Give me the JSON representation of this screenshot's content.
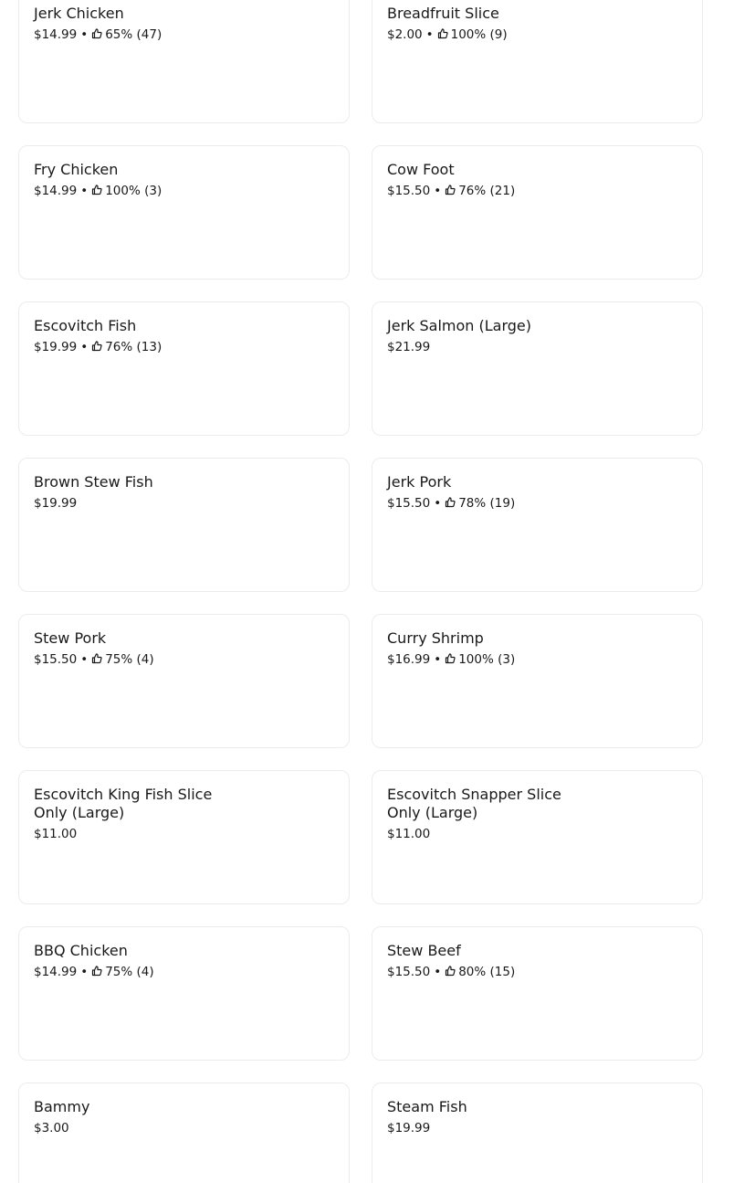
{
  "menu": {
    "items": [
      {
        "name": "Jerk Chicken",
        "price": "$14.99",
        "rating": "65% (47)"
      },
      {
        "name": "Breadfruit Slice",
        "price": "$2.00",
        "rating": "100% (9)"
      },
      {
        "name": "Fry Chicken",
        "price": "$14.99",
        "rating": "100% (3)"
      },
      {
        "name": "Cow Foot",
        "price": "$15.50",
        "rating": "76% (21)"
      },
      {
        "name": "Escovitch Fish",
        "price": "$19.99",
        "rating": "76% (13)"
      },
      {
        "name": "Jerk Salmon (Large)",
        "price": "$21.99",
        "rating": null
      },
      {
        "name": "Brown Stew Fish",
        "price": "$19.99",
        "rating": null
      },
      {
        "name": "Jerk Pork",
        "price": "$15.50",
        "rating": "78% (19)"
      },
      {
        "name": "Stew Pork",
        "price": "$15.50",
        "rating": "75% (4)"
      },
      {
        "name": "Curry Shrimp",
        "price": "$16.99",
        "rating": "100% (3)"
      },
      {
        "name": "Escovitch King Fish Slice Only (Large)",
        "price": "$11.00",
        "rating": null
      },
      {
        "name": "Escovitch Snapper Slice Only (Large)",
        "price": "$11.00",
        "rating": null
      },
      {
        "name": "BBQ Chicken",
        "price": "$14.99",
        "rating": "75% (4)"
      },
      {
        "name": "Stew Beef",
        "price": "$15.50",
        "rating": "80% (15)"
      },
      {
        "name": "Bammy",
        "price": "$3.00",
        "rating": null
      },
      {
        "name": "Steam Fish",
        "price": "$19.99",
        "rating": null
      }
    ],
    "separator": "•",
    "rating_icon": "thumbs-up-icon"
  }
}
